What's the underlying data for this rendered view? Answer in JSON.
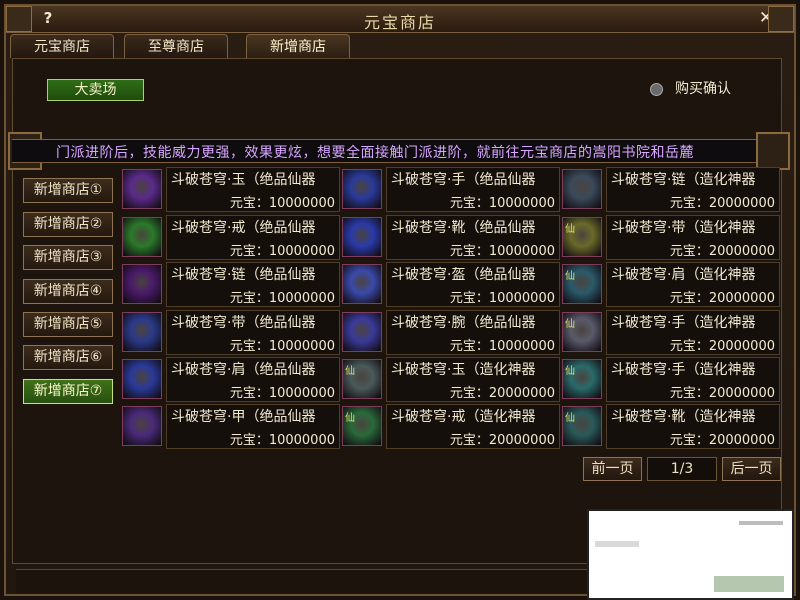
{
  "window": {
    "title": "元宝商店",
    "help": "?",
    "close": "✕"
  },
  "tabs": [
    {
      "label": "元宝商店",
      "active": false
    },
    {
      "label": "至尊商店",
      "active": false
    },
    {
      "label": "新增商店",
      "active": true
    }
  ],
  "toolbar": {
    "auction_label": "大卖场",
    "confirm_label": "购买确认"
  },
  "marquee": {
    "text": "门派进阶后，技能威力更强，效果更炫，想要全面接触门派进阶，就前往元宝商店的嵩阳书院和岳麓"
  },
  "side_tabs": [
    {
      "label": "新增商店①",
      "active": false
    },
    {
      "label": "新增商店②",
      "active": false
    },
    {
      "label": "新增商店③",
      "active": false
    },
    {
      "label": "新增商店④",
      "active": false
    },
    {
      "label": "新增商店⑤",
      "active": false
    },
    {
      "label": "新增商店⑥",
      "active": false
    },
    {
      "label": "新增商店⑦",
      "active": true
    }
  ],
  "items": [
    {
      "name": "斗破苍穹·玉（绝品仙器",
      "price": "元宝：10000000",
      "icon": "purple-beast-icon",
      "color": "#5a2a8a"
    },
    {
      "name": "斗破苍穹·手（绝品仙器",
      "price": "元宝：10000000",
      "icon": "blue-gauntlet-icon",
      "color": "#2a3a9a"
    },
    {
      "name": "斗破苍穹·链（造化神器",
      "price": "元宝：20000000",
      "icon": "armored-knight-icon",
      "color": "#3a4a5a"
    },
    {
      "name": "斗破苍穹·戒（绝品仙器",
      "price": "元宝：10000000",
      "icon": "green-ring-icon",
      "color": "#2a7a2a"
    },
    {
      "name": "斗破苍穹·靴（绝品仙器",
      "price": "元宝：10000000",
      "icon": "blue-boots-icon",
      "color": "#2a3aaa"
    },
    {
      "name": "斗破苍穹·带（造化神器",
      "price": "元宝：20000000",
      "icon": "gold-belt-icon",
      "color": "#6a6a2a",
      "badge": "仙"
    },
    {
      "name": "斗破苍穹·链（绝品仙器",
      "price": "元宝：10000000",
      "icon": "purple-necklace-icon",
      "color": "#4a1a6a"
    },
    {
      "name": "斗破苍穹·盔（绝品仙器",
      "price": "元宝：10000000",
      "icon": "blue-helmet-icon",
      "color": "#3a4aaa"
    },
    {
      "name": "斗破苍穹·肩（造化神器",
      "price": "元宝：20000000",
      "icon": "teal-shoulder-icon",
      "color": "#2a5a6a",
      "badge": "仙"
    },
    {
      "name": "斗破苍穹·带（绝品仙器",
      "price": "元宝：10000000",
      "icon": "blue-belt-icon",
      "color": "#2a3a8a"
    },
    {
      "name": "斗破苍穹·腕（绝品仙器",
      "price": "元宝：10000000",
      "icon": "blue-bracer-icon",
      "color": "#3a3a9a"
    },
    {
      "name": "斗破苍穹·手（造化神器",
      "price": "元宝：20000000",
      "icon": "silver-gauntlet-icon",
      "color": "#5a5a6a",
      "badge": "仙"
    },
    {
      "name": "斗破苍穹·肩（绝品仙器",
      "price": "元宝：10000000",
      "icon": "blue-shoulder-icon",
      "color": "#2a3a9a"
    },
    {
      "name": "斗破苍穹·玉（造化神器",
      "price": "元宝：20000000",
      "icon": "silver-jade-icon",
      "color": "#4a5a5a",
      "badge": "仙"
    },
    {
      "name": "斗破苍穹·手（造化神器",
      "price": "元宝：20000000",
      "icon": "teal-glove-icon",
      "color": "#2a6a6a",
      "badge": "仙"
    },
    {
      "name": "斗破苍穹·甲（绝品仙器",
      "price": "元宝：10000000",
      "icon": "purple-armor-icon",
      "color": "#4a2a7a"
    },
    {
      "name": "斗破苍穹·戒（造化神器",
      "price": "元宝：20000000",
      "icon": "green-gold-ring-icon",
      "color": "#2a6a3a",
      "badge": "仙"
    },
    {
      "name": "斗破苍穹·靴（造化神器",
      "price": "元宝：20000000",
      "icon": "teal-boots-icon",
      "color": "#2a5a5a",
      "badge": "仙"
    }
  ],
  "pager": {
    "prev": "前一页",
    "page": "1/3",
    "next": "后一页"
  }
}
